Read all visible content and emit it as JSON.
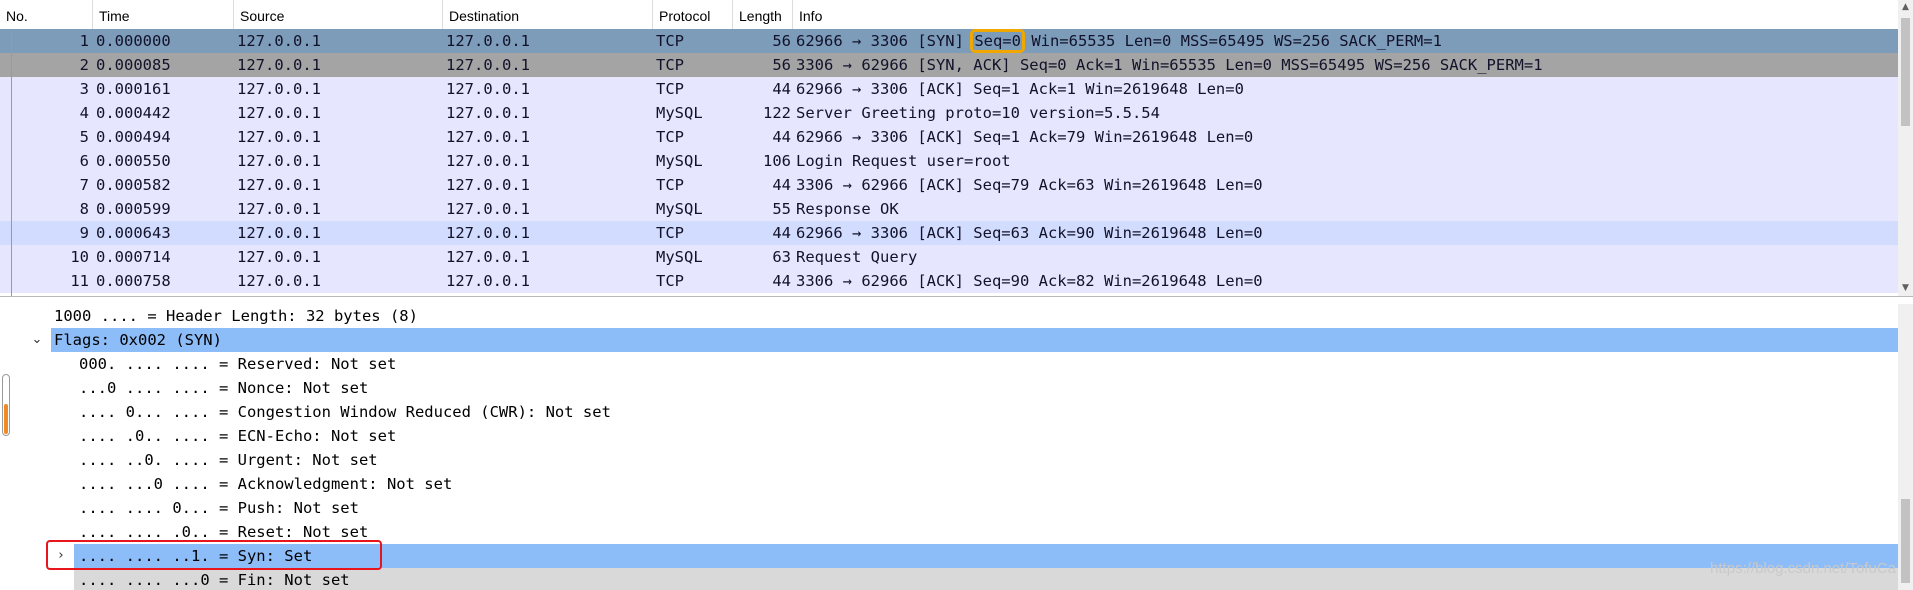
{
  "packet_list": {
    "columns": [
      "No.",
      "Time",
      "Source",
      "Destination",
      "Protocol",
      "Length",
      "Info"
    ],
    "rows": [
      {
        "no": "1",
        "time": "0.000000",
        "src": "127.0.0.1",
        "dst": "127.0.0.1",
        "proto": "TCP",
        "len": "56",
        "info_pre": "62966 → 3306 [SYN] ",
        "info_box": "Seq=0",
        "info_post": " Win=65535 Len=0 MSS=65495 WS=256 SACK_PERM=1",
        "state": "selected"
      },
      {
        "no": "2",
        "time": "0.000085",
        "src": "127.0.0.1",
        "dst": "127.0.0.1",
        "proto": "TCP",
        "len": "56",
        "info_pre": "3306 → 62966 [SYN, ACK] Seq=0 Ack=1 Win=65535 Len=0 MSS=65495 WS=256 SACK_PERM=1",
        "info_box": "",
        "info_post": "",
        "state": "related"
      },
      {
        "no": "3",
        "time": "0.000161",
        "src": "127.0.0.1",
        "dst": "127.0.0.1",
        "proto": "TCP",
        "len": "44",
        "info_pre": "62966 → 3306 [ACK] Seq=1 Ack=1 Win=2619648 Len=0",
        "info_box": "",
        "info_post": "",
        "state": "normal"
      },
      {
        "no": "4",
        "time": "0.000442",
        "src": "127.0.0.1",
        "dst": "127.0.0.1",
        "proto": "MySQL",
        "len": "122",
        "info_pre": "Server Greeting proto=10 version=5.5.54",
        "info_box": "",
        "info_post": "",
        "state": "normal"
      },
      {
        "no": "5",
        "time": "0.000494",
        "src": "127.0.0.1",
        "dst": "127.0.0.1",
        "proto": "TCP",
        "len": "44",
        "info_pre": "62966 → 3306 [ACK] Seq=1 Ack=79 Win=2619648 Len=0",
        "info_box": "",
        "info_post": "",
        "state": "normal"
      },
      {
        "no": "6",
        "time": "0.000550",
        "src": "127.0.0.1",
        "dst": "127.0.0.1",
        "proto": "MySQL",
        "len": "106",
        "info_pre": "Login Request user=root",
        "info_box": "",
        "info_post": "",
        "state": "normal"
      },
      {
        "no": "7",
        "time": "0.000582",
        "src": "127.0.0.1",
        "dst": "127.0.0.1",
        "proto": "TCP",
        "len": "44",
        "info_pre": "3306 → 62966 [ACK] Seq=79 Ack=63 Win=2619648 Len=0",
        "info_box": "",
        "info_post": "",
        "state": "normal"
      },
      {
        "no": "8",
        "time": "0.000599",
        "src": "127.0.0.1",
        "dst": "127.0.0.1",
        "proto": "MySQL",
        "len": "55",
        "info_pre": "Response OK",
        "info_box": "",
        "info_post": "",
        "state": "normal"
      },
      {
        "no": "9",
        "time": "0.000643",
        "src": "127.0.0.1",
        "dst": "127.0.0.1",
        "proto": "TCP",
        "len": "44",
        "info_pre": "62966 → 3306 [ACK] Seq=63 Ack=90 Win=2619648 Len=0",
        "info_box": "",
        "info_post": "",
        "state": "hover"
      },
      {
        "no": "10",
        "time": "0.000714",
        "src": "127.0.0.1",
        "dst": "127.0.0.1",
        "proto": "MySQL",
        "len": "63",
        "info_pre": "Request Query",
        "info_box": "",
        "info_post": "",
        "state": "normal"
      },
      {
        "no": "11",
        "time": "0.000758",
        "src": "127.0.0.1",
        "dst": "127.0.0.1",
        "proto": "TCP",
        "len": "44",
        "info_pre": "3306 → 62966 [ACK] Seq=90 Ack=82 Win=2619648 Len=0",
        "info_box": "",
        "info_post": "",
        "state": "normal"
      }
    ]
  },
  "details": {
    "header_length": "1000 .... = Header Length: 32 bytes (8)",
    "flags": "Flags: 0x002 (SYN)",
    "reserved": "000. .... .... = Reserved: Not set",
    "nonce": "...0 .... .... = Nonce: Not set",
    "cwr": ".... 0... .... = Congestion Window Reduced (CWR): Not set",
    "ecn": ".... .0.. .... = ECN-Echo: Not set",
    "urgent": ".... ..0. .... = Urgent: Not set",
    "ack": ".... ...0 .... = Acknowledgment: Not set",
    "push": ".... .... 0... = Push: Not set",
    "reset": ".... .... .0.. = Reset: Not set",
    "syn": ".... .... ..1. = Syn: Set",
    "fin": ".... .... ...0 = Fin: Not set"
  },
  "watermark": "https://blog.csdn.net/TofuCa",
  "colors": {
    "selected_row": "#7d9cba",
    "related_row": "#a4a4a4",
    "tcp_row": "#e7e6ff",
    "selected_detail": "#8dbdf8",
    "annotation_orange": "#f0a800",
    "annotation_red": "#e8161c"
  }
}
